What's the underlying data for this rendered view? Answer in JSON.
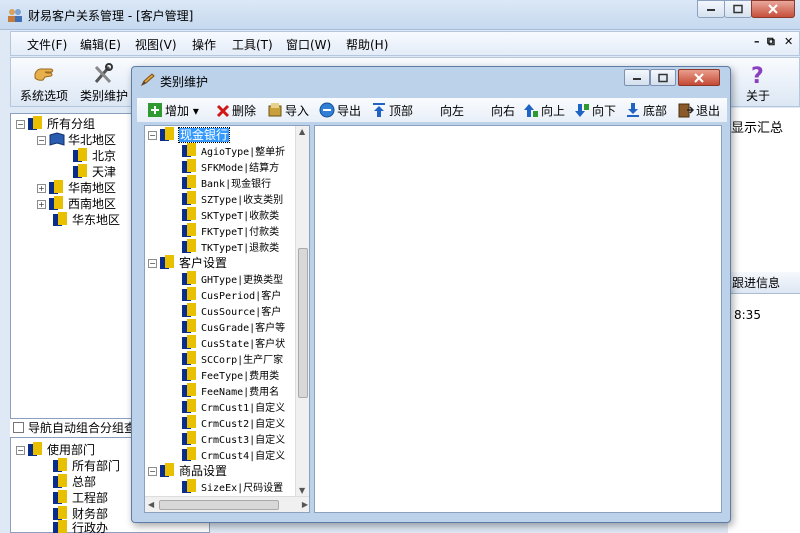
{
  "window": {
    "title": "财易客户关系管理 - [客户管理]"
  },
  "menu": [
    "文件(F)",
    "编辑(E)",
    "视图(V)",
    "操作",
    "工具(T)",
    "窗口(W)",
    "帮助(H)"
  ],
  "toolbar": {
    "system_options": "系统选项",
    "category_maintenance": "类别维护",
    "about": "关于"
  },
  "left_tree": {
    "root": "所有分组",
    "north": "华北地区",
    "beijing": "北京",
    "tianjin": "天津",
    "south": "华南地区",
    "southwest": "西南地区",
    "east": "华东地区"
  },
  "nav_option": "导航自动组合分组查",
  "dept_tree": {
    "root": "使用部门",
    "all": "所有部门",
    "hq": "总部",
    "eng": "工程部",
    "fin": "财务部",
    "admin": "行政办"
  },
  "right_area": {
    "summary": "显示汇总",
    "tab": "跟进信息",
    "time": "8:35"
  },
  "dialog": {
    "title": "类别维护",
    "actions": {
      "add": "增加",
      "delete": "删除",
      "import": "导入",
      "export": "导出",
      "top": "顶部",
      "left": "向左",
      "right": "向右",
      "up": "向上",
      "down": "向下",
      "bottom": "底部",
      "exit": "退出"
    },
    "tree": {
      "cash_bank": "现金银行",
      "agio": "AgioType|整单折",
      "sfk": "SFKMode|结算方",
      "bank": "Bank|现金银行",
      "sz": "SZType|收支类别",
      "sk": "SKTypeT|收款类",
      "fk": "FKTypeT|付款类",
      "tk": "TKTypeT|退款类",
      "customer_settings": "客户设置",
      "gh": "GHType|更换类型",
      "cusperiod": "CusPeriod|客户",
      "cussource": "CusSource|客户",
      "cusgrade": "CusGrade|客户等",
      "cusstate": "CusState|客户状",
      "sccorp": "SCCorp|生产厂家",
      "feetype": "FeeType|费用类",
      "feename": "FeeName|费用名",
      "crm1": "CrmCust1|自定义",
      "crm2": "CrmCust2|自定义",
      "crm3": "CrmCust3|自定义",
      "crm4": "CrmCust4|自定义",
      "product_settings": "商品设置",
      "sizeex": "SizeEx|尺码设置"
    }
  }
}
